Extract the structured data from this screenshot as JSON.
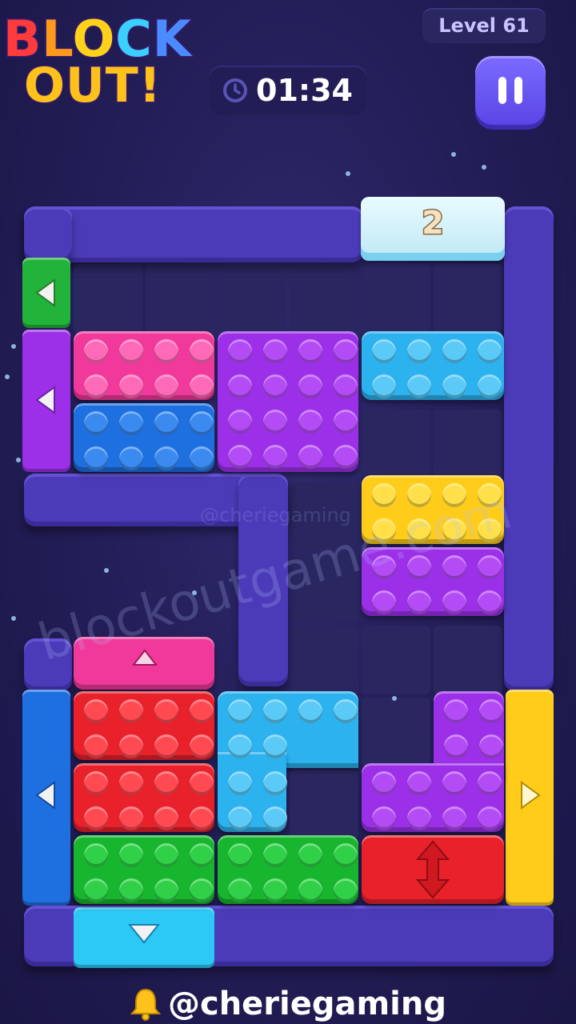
{
  "header": {
    "logo_line1": [
      "B",
      "L",
      "O",
      "C",
      "K"
    ],
    "logo_line2": "OUT!",
    "level_label": "Level 61",
    "timer": "01:34"
  },
  "icons": {
    "timer": "clock-icon",
    "pause": "pause-icon",
    "footer": "bell-icon"
  },
  "colors": {
    "pink": "#f0399a",
    "purple": "#9b30e8",
    "cyan": "#2cb2ee",
    "blue": "#1e6fe0",
    "yellow": "#ffcc1a",
    "red": "#e8212b",
    "green": "#18b52e",
    "wall": "#4b3bb8"
  },
  "board": {
    "frozen_block_counter": "2"
  },
  "watermark": {
    "large": "blockoutgame.com",
    "small": "@cheriegaming"
  },
  "footer": {
    "handle": "@cheriegaming"
  }
}
